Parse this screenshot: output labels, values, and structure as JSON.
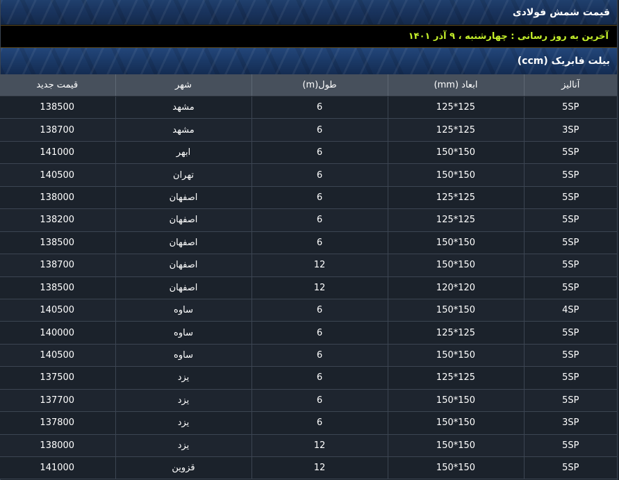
{
  "header": {
    "title": "قیمت شمش فولادی"
  },
  "update": {
    "text": "آخرین به روز رسانی : چهارشنبه ، ۹ آذر ۱۴۰۱"
  },
  "section": {
    "title": "بیلت فابریک (ccm)"
  },
  "table": {
    "columns": [
      "آنالیز",
      "ابعاد (mm)",
      "طول(m)",
      "شهر",
      "قیمت جدید"
    ],
    "rows": [
      [
        "5SP",
        "125*125",
        "6",
        "مشهد",
        "138500"
      ],
      [
        "3SP",
        "125*125",
        "6",
        "مشهد",
        "138700"
      ],
      [
        "5SP",
        "150*150",
        "6",
        "ابهر",
        "141000"
      ],
      [
        "5SP",
        "150*150",
        "6",
        "تهران",
        "140500"
      ],
      [
        "5SP",
        "125*125",
        "6",
        "اصفهان",
        "138000"
      ],
      [
        "5SP",
        "125*125",
        "6",
        "اصفهان",
        "138200"
      ],
      [
        "5SP",
        "150*150",
        "6",
        "اصفهان",
        "138500"
      ],
      [
        "5SP",
        "150*150",
        "12",
        "اصفهان",
        "138700"
      ],
      [
        "5SP",
        "120*120",
        "12",
        "اصفهان",
        "138500"
      ],
      [
        "4SP",
        "150*150",
        "6",
        "ساوه",
        "140500"
      ],
      [
        "5SP",
        "125*125",
        "6",
        "ساوه",
        "140000"
      ],
      [
        "5SP",
        "150*150",
        "6",
        "ساوه",
        "140500"
      ],
      [
        "5SP",
        "125*125",
        "6",
        "یزد",
        "137500"
      ],
      [
        "5SP",
        "150*150",
        "6",
        "یزد",
        "137700"
      ],
      [
        "3SP",
        "150*150",
        "6",
        "یزد",
        "137800"
      ],
      [
        "5SP",
        "150*150",
        "12",
        "یزد",
        "138000"
      ],
      [
        "5SP",
        "150*150",
        "12",
        "قزوین",
        "141000"
      ]
    ]
  },
  "colors": {
    "header_bg": "#1a3560",
    "update_text": "#c4ef2a",
    "table_header_bg": "#47505c",
    "row_bg": "#1b222b"
  }
}
